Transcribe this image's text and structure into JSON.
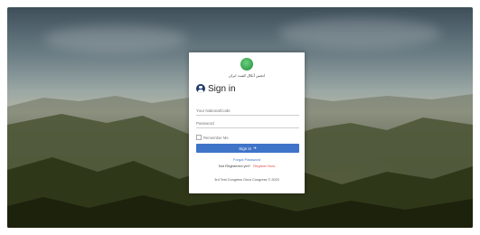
{
  "org": {
    "name": "انجمن آنکال کشت ایران"
  },
  "login": {
    "title": "Sign in",
    "national_code_placeholder": "Your NationalCode",
    "password_placeholder": "Password",
    "remember_label": "Remember Me",
    "signin_label": "Sign in",
    "forgot_label": "Forgot Password",
    "not_registered_label": "Not Registered yet?",
    "register_label": "Register Now",
    "footer": "3rd Test Congress Onco Congress © 2020"
  },
  "colors": {
    "primary": "#3f74c8",
    "link_red": "#d9534f",
    "logo_green": "#2fae4e"
  },
  "icons": [
    "logo-icon",
    "user-circle-icon",
    "arrow-right-icon"
  ]
}
